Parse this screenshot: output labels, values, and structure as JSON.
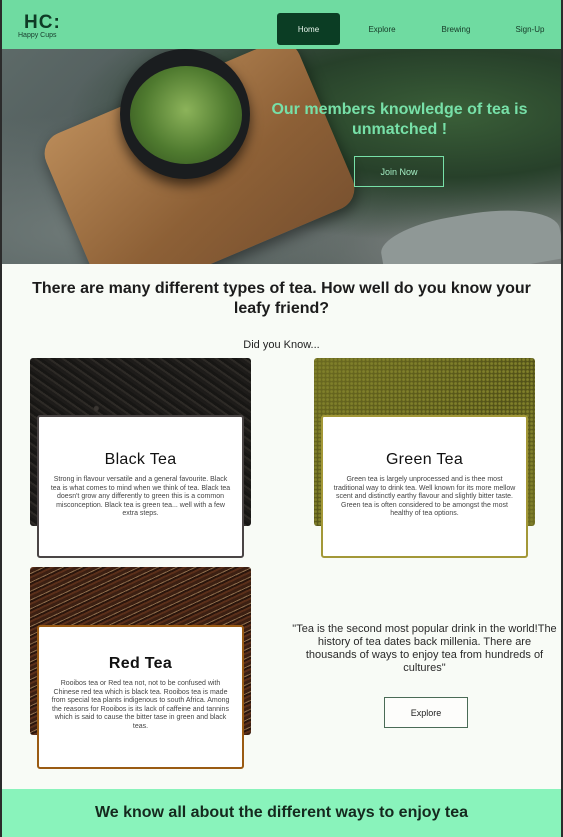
{
  "header": {
    "logo_mark": "HC:",
    "logo_sub": "Happy Cups",
    "nav": {
      "home": "Home",
      "explore": "Explore",
      "brewing": "Brewing",
      "signup": "Sign-Up"
    }
  },
  "hero": {
    "title": "Our members knowledge of tea is unmatched !",
    "button": "Join Now"
  },
  "intro": {
    "title": "There are many different types of tea. How well do you know your leafy friend?",
    "subtitle": "Did you Know..."
  },
  "cards": {
    "black": {
      "title": "Black Tea",
      "text": "Strong in flavour versatile and a general favourite. Black tea is what comes to mind when we think of tea. Black tea doesn't grow any differently to green this is a common misconception. Black tea is green tea... well with a few extra steps."
    },
    "green": {
      "title": "Green Tea",
      "text": "Green tea is largely unprocessed and is thee most traditional way to drink tea. Well known for its more mellow scent and distinctly earthy flavour and slightly bitter taste. Green tea is often considered to be amongst the most healthy of tea options."
    },
    "red": {
      "title": "Red Tea",
      "text": "Rooibos tea or Red tea not, not to be confused with Chinese red tea which is black tea. Rooibos tea is made from special tea plants indigenous to south Africa. Among the reasons for Rooibos is its lack of caffeine and tannins which is said to cause the bitter tase in green and black teas."
    }
  },
  "quote": {
    "text": "\"Tea is the second most popular drink in the world!The history of tea dates back millenia. There are thousands of ways to enjoy tea from hundreds of cultures\"",
    "button": "Explore"
  },
  "banner": {
    "text": "We know all about the different ways to enjoy tea"
  },
  "colors": {
    "header_bg": "#6fdba1",
    "active_nav_bg": "#0b3d24",
    "hero_accent": "#77e0a8",
    "banner_bg": "#89f3bb",
    "black_card_border": "#4a4545",
    "green_card_border": "#a39838",
    "red_card_border": "#9a5b13"
  }
}
